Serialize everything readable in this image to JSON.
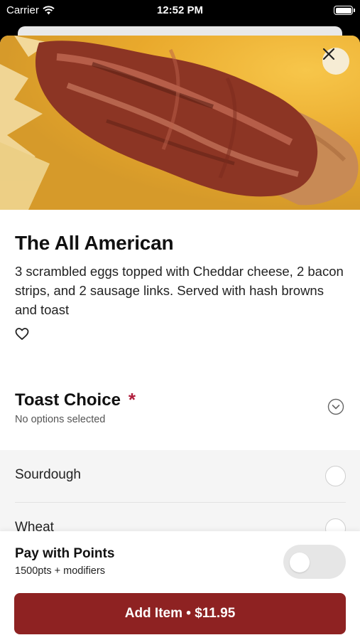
{
  "status_bar": {
    "carrier": "Carrier",
    "time": "12:52 PM"
  },
  "item": {
    "name": "The All American",
    "description": "3 scrambled eggs topped with Cheddar cheese, 2 bacon strips, and 2 sausage links. Served with hash browns and toast"
  },
  "modifier_group": {
    "title": "Toast Choice",
    "required_marker": "*",
    "status": "No options selected",
    "options": [
      {
        "label": "Sourdough",
        "selected": false
      },
      {
        "label": "Wheat",
        "selected": false
      }
    ]
  },
  "points": {
    "title": "Pay with Points",
    "subtitle": "1500pts + modifiers",
    "enabled": false
  },
  "add_button": {
    "label": "Add Item • $11.95"
  },
  "icons": {
    "close": "close-icon",
    "favorite": "heart-icon",
    "expand": "chevron-down-circle-icon",
    "wifi": "wifi-icon",
    "battery": "battery-icon"
  },
  "colors": {
    "accent": "#8e2222",
    "required": "#b01e3c",
    "toggle_off": "#e6e6e6"
  }
}
